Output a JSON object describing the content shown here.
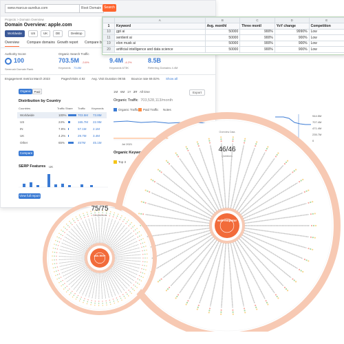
{
  "topbar": {
    "url": "www.marcus-aurelius.com",
    "root_domain": "Root Domain",
    "search": "Search"
  },
  "breadcrumb": "Projects > Domain Overview",
  "title": "Domain Overview: apple.com",
  "db_chips": [
    "Worldwide",
    "US",
    "UK",
    "DE",
    "Desktop"
  ],
  "tabs": [
    "Overview",
    "Compare domains",
    "Growth report",
    "Compare by"
  ],
  "metrics": {
    "authority_label": "Authority Score",
    "authority_value": "100",
    "authority_sub": "Semrush Domain Rank",
    "organic_label": "Organic Search Traffic",
    "organic_value": "703.5M",
    "organic_change": "-3.6%",
    "organic_sub": "Keywords",
    "organic_kw": "73.8M",
    "paid_label": "Paid Search Traffic",
    "paid_value": "9.4M",
    "paid_change": "-4.2%",
    "paid_sub": "Keywords 673K",
    "backlinks_label": "Backlinks",
    "backlinks_value": "8.5B",
    "backlinks_sub": "Referring Domains 4.4M"
  },
  "engagement": {
    "label": "Engagement metrics",
    "month": "March 2023",
    "pages": "Pages/Visits 4.92",
    "duration": "Avg. Visit Duration 09:55",
    "bounce": "Bounce rate 69.02%",
    "showall": "Show all"
  },
  "toggle": {
    "organic": "Organic",
    "paid": "Paid"
  },
  "distribution": {
    "title": "Distribution by Country",
    "headers": [
      "Countries",
      "Traffic Share",
      "Traffic",
      "Keywords"
    ],
    "rows": [
      {
        "country": "Worldwide",
        "share": "100%",
        "traffic": "703.5M",
        "keywords": "73.8M"
      },
      {
        "country": "US",
        "share": "24%",
        "traffic": "165.7M",
        "keywords": "22.9M"
      },
      {
        "country": "IN",
        "share": "7.9%",
        "traffic": "57.1M",
        "keywords": "2.1M"
      },
      {
        "country": "UK",
        "share": "4.2%",
        "traffic": "29.7M",
        "keywords": "3.4M"
      },
      {
        "country": "Other",
        "share": "65%",
        "traffic": "457M",
        "keywords": "45.1M"
      }
    ],
    "compare": "Compare"
  },
  "serp": {
    "title": "SERP Features",
    "country": "UK",
    "btn": "View full report"
  },
  "period": {
    "ranges": [
      "1M",
      "6M",
      "1Y",
      "2Y",
      "All time"
    ],
    "export": "Export"
  },
  "organic_traffic": {
    "title": "Organic Traffic",
    "value": "703,528,113/month",
    "legend_organic": "Organic Traffic",
    "legend_paid": "Paid Traffic",
    "notes": "Notes",
    "x_label": "Jul 2021",
    "y_ticks": [
      "944.5M",
      "707.4M",
      "471.4M",
      "235.7M",
      "0"
    ]
  },
  "organic_kw": {
    "title": "Organic Keywor",
    "legend": "Top 3"
  },
  "kwtable": {
    "col_letters": [
      "",
      "A",
      "B",
      "C",
      "D",
      "E"
    ],
    "headers": [
      "Keyword",
      "Avg. monthl",
      "Three montl",
      "YoY change",
      "Competition"
    ],
    "rows": [
      {
        "n": "1",
        "keyword": "Keyword",
        "a": "Avg. monthl",
        "b": "Three montl",
        "c": "YoY change",
        "d": "Competition"
      },
      {
        "n": "10",
        "keyword": "gpt ai",
        "a": "50000",
        "b": "900%",
        "c": "9990%",
        "d": "Low"
      },
      {
        "n": "11",
        "keyword": "sentient ai",
        "a": "50000",
        "b": "900%",
        "c": "900%",
        "d": "Low"
      },
      {
        "n": "19",
        "keyword": "elon musk ai",
        "a": "50000",
        "b": "900%",
        "c": "900%",
        "d": "Low"
      },
      {
        "n": "20",
        "keyword": "artificial intelligence and data science",
        "a": "50000",
        "b": "900%",
        "c": "900%",
        "d": "Low"
      }
    ]
  },
  "wheel_big": {
    "count": "46/46",
    "sub": "Questions",
    "hub": "web-empotor",
    "hub_sub": "COUNTING",
    "top_note": "Overview Data"
  },
  "wheel_small": {
    "count": "75/75",
    "sub": "Comparisons",
    "hub": "ask-filter"
  },
  "colors": {
    "accent": "#ff642d",
    "blue": "#3b7bd4",
    "hub": "#f26b3a",
    "ring": "#f7c9b3"
  }
}
